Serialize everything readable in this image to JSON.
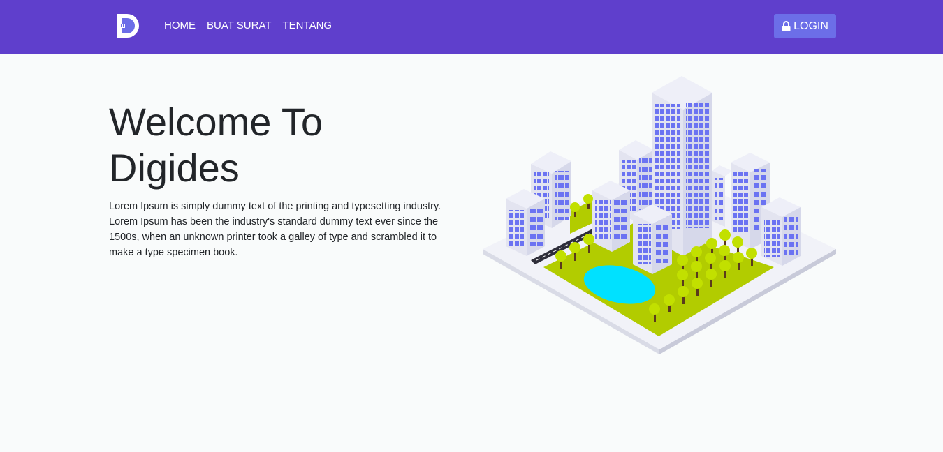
{
  "navbar": {
    "background": "#5f3fcc",
    "logo_icon": "digides-logo-icon",
    "links": [
      {
        "label": "HOME"
      },
      {
        "label": "BUAT SURAT"
      },
      {
        "label": "TENTANG"
      }
    ],
    "login": {
      "label": "LOGIN",
      "icon": "lock-icon",
      "background": "#6c6ee8"
    }
  },
  "hero": {
    "title": "Welcome To Digides",
    "text": "Lorem Ipsum is simply dummy text of the printing and typesetting industry. Lorem Ipsum has been the industry's standard dummy text ever since the 1500s, when an unknown printer took a galley of type and scrambled it to make a type specimen book.",
    "illustration": "isometric-city-illustration"
  }
}
